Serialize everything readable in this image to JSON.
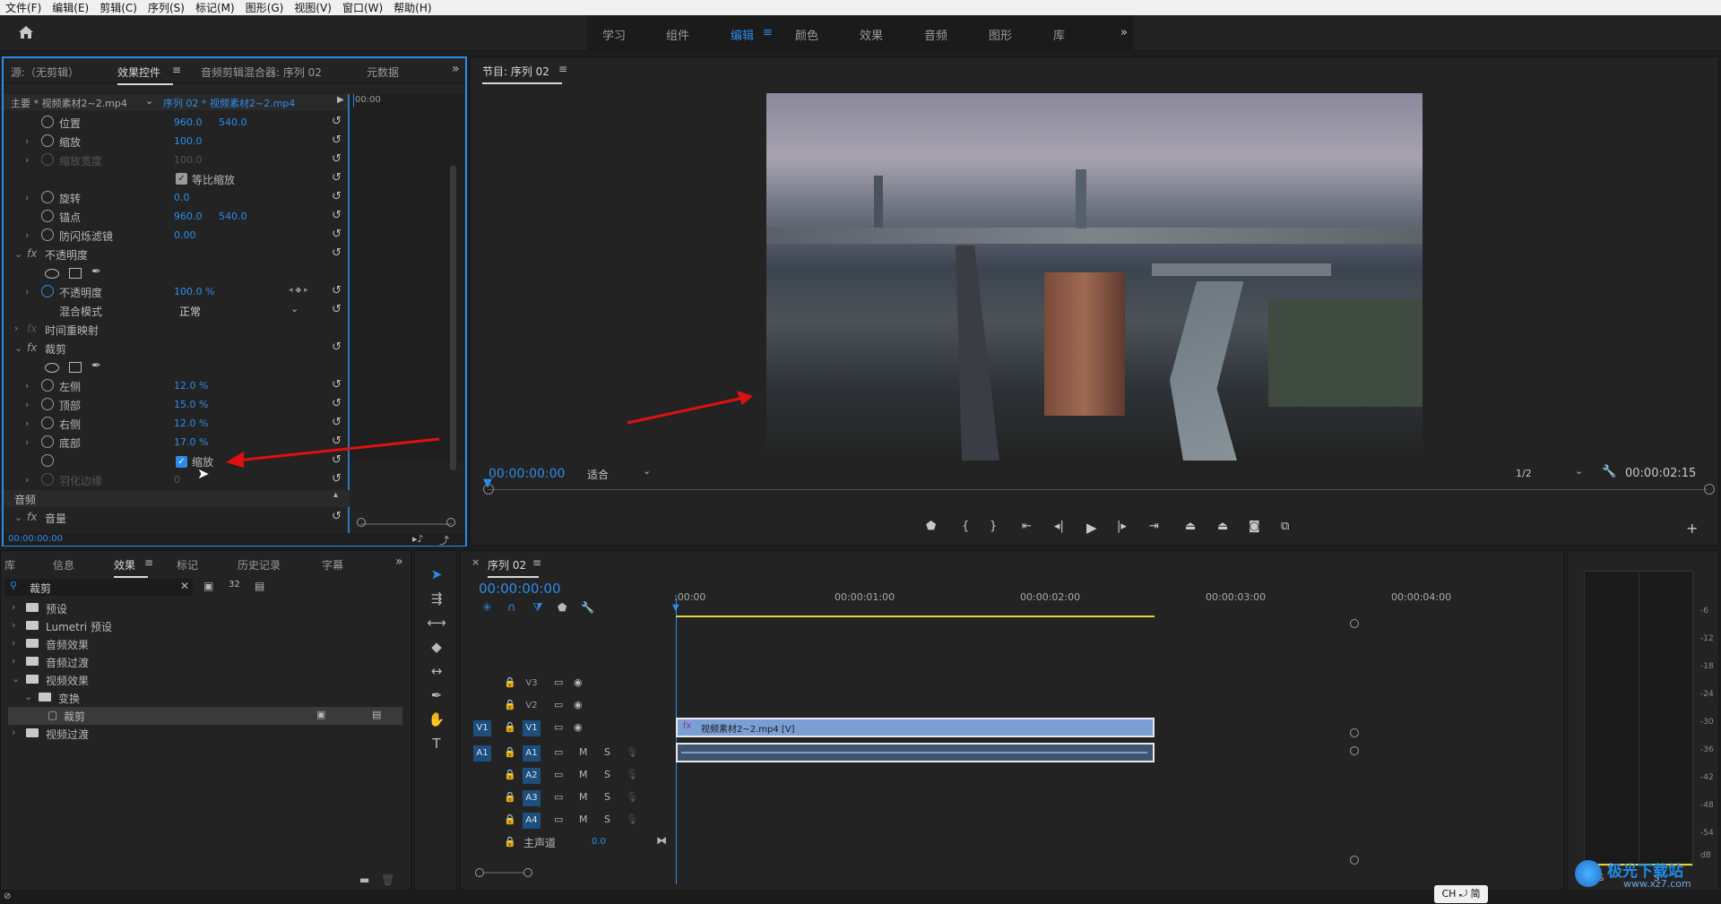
{
  "menu": [
    "文件(F)",
    "编辑(E)",
    "剪辑(C)",
    "序列(S)",
    "标记(M)",
    "图形(G)",
    "视图(V)",
    "窗口(W)",
    "帮助(H)"
  ],
  "workspaces": [
    "学习",
    "组件",
    "编辑",
    "颜色",
    "效果",
    "音频",
    "图形",
    "库"
  ],
  "active_workspace": "编辑",
  "effect_panel": {
    "tabs": [
      "源:（无剪辑）",
      "效果控件",
      "音频剪辑混合器: 序列 02",
      "元数据"
    ],
    "master_clip": "主要 * 视频素材2~2.mp4",
    "seq_clip": "序列 02 * 视频素材2~2.mp4",
    "mini_time": "00:00",
    "rows": [
      {
        "label": "位置",
        "v1": "960.0",
        "v2": "540.0"
      },
      {
        "label": "缩放",
        "v1": "100.0",
        "v2": ""
      },
      {
        "label": "缩放宽度",
        "v1": "100.0",
        "v2": ""
      },
      {
        "label": "等比缩放",
        "v1": "",
        "v2": ""
      },
      {
        "label": "旋转",
        "v1": "0.0",
        "v2": ""
      },
      {
        "label": "锚点",
        "v1": "960.0",
        "v2": "540.0"
      },
      {
        "label": "防闪烁滤镜",
        "v1": "0.00",
        "v2": ""
      },
      {
        "label": "不透明度",
        "v1": "",
        "v2": ""
      },
      {
        "label": "",
        "v1": "",
        "v2": ""
      },
      {
        "label": "不透明度",
        "v1": "100.0 %",
        "v2": ""
      },
      {
        "label": "混合模式",
        "v1": "正常",
        "v2": ""
      },
      {
        "label": "时间重映射",
        "v1": "",
        "v2": ""
      },
      {
        "label": "裁剪",
        "v1": "",
        "v2": ""
      },
      {
        "label": "",
        "v1": "",
        "v2": ""
      },
      {
        "label": "左侧",
        "v1": "12.0 %",
        "v2": ""
      },
      {
        "label": "顶部",
        "v1": "15.0 %",
        "v2": ""
      },
      {
        "label": "右侧",
        "v1": "12.0 %",
        "v2": ""
      },
      {
        "label": "底部",
        "v1": "17.0 %",
        "v2": ""
      },
      {
        "label": "缩放",
        "v1": "",
        "v2": ""
      },
      {
        "label": "羽化边缘",
        "v1": "0",
        "v2": ""
      }
    ],
    "audio_label": "音频",
    "volume_label": "音量",
    "timecode": "00:00:00:00"
  },
  "program": {
    "title": "节目: 序列 02",
    "timecode": "00:00:00:00",
    "fit": "适合",
    "resolution": "1/2",
    "duration": "00:00:02:15"
  },
  "library": {
    "tabs": [
      "库",
      "信息",
      "效果",
      "标记",
      "历史记录",
      "字幕"
    ],
    "search_value": "裁剪",
    "items": [
      {
        "label": "预设",
        "indent": 0
      },
      {
        "label": "Lumetri 预设",
        "indent": 0
      },
      {
        "label": "音频效果",
        "indent": 0
      },
      {
        "label": "音频过渡",
        "indent": 0
      },
      {
        "label": "视频效果",
        "indent": 0
      },
      {
        "label": "变换",
        "indent": 1
      },
      {
        "label": "裁剪",
        "indent": 2
      },
      {
        "label": "视频过渡",
        "indent": 0
      }
    ]
  },
  "timeline": {
    "title": "序列 02",
    "timecode": "00:00:00:00",
    "ruler": [
      ":00:00",
      "00:00:01:00",
      "00:00:02:00",
      "00:00:03:00",
      "00:00:04:00"
    ],
    "video_tracks": [
      "V3",
      "V2",
      "V1"
    ],
    "audio_tracks": [
      "A1",
      "A2",
      "A3",
      "A4"
    ],
    "mix_label": "主声道",
    "mix_value": "0.0",
    "clip_label": "视频素材2~2.mp4 [V]",
    "src_v": "V1",
    "src_a": "A1"
  },
  "meter": {
    "db_labels": [
      "-6",
      "-12",
      "-18",
      "-24",
      "-30",
      "-36",
      "-42",
      "-48",
      "-54",
      "dB"
    ],
    "solo": [
      "S",
      "S"
    ]
  },
  "ime": "CH ⤾ 简",
  "watermark": "极光下载站",
  "watermark_url": "www.xz7.com"
}
